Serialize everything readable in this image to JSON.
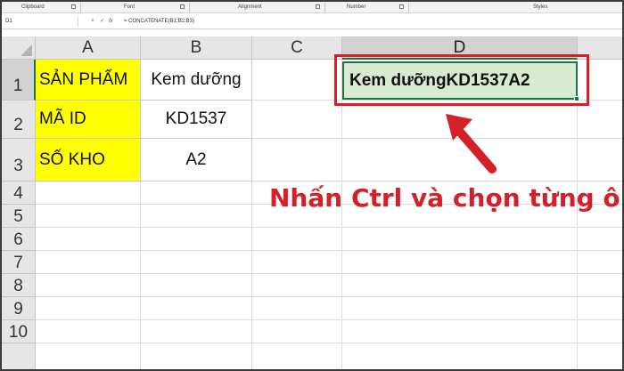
{
  "ribbon": {
    "groups": [
      "Clipboard",
      "Font",
      "Alignment",
      "Number",
      "Styles"
    ]
  },
  "formula_bar": {
    "name_box": "D1",
    "cancel_symbol": "×",
    "enter_symbol": "✓",
    "fx_label": "fx",
    "formula": "= CONCATENATE(B1;B2;B3)"
  },
  "columns": [
    "A",
    "B",
    "C",
    "D"
  ],
  "rows": [
    "1",
    "2",
    "3",
    "4",
    "5",
    "6",
    "7",
    "8",
    "9",
    "10"
  ],
  "cells": {
    "A1": "SẢN PHẨM",
    "A2": "MÃ ID",
    "A3": "SỐ KHO",
    "B1": "Kem dưỡng",
    "B2": "KD1537",
    "B3": "A2",
    "D1": "Kem dưỡngKD1537A2"
  },
  "annotation": "Nhấn Ctrl và chọn từng ô",
  "colors": {
    "label_fill": "#ffff00",
    "highlight": "#d32029",
    "selection": "#217346",
    "active_fill": "#d9ead3"
  },
  "icons": [
    "arrow-icon",
    "select-all-icon",
    "dialog-launcher-icon"
  ]
}
